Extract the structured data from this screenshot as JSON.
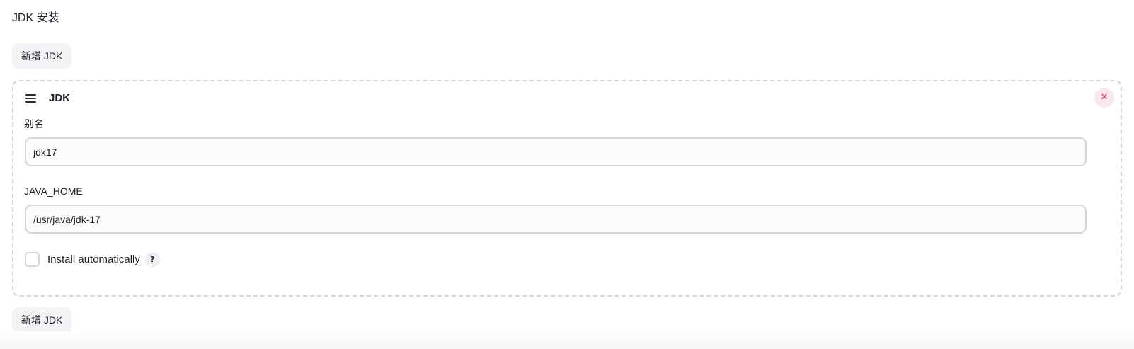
{
  "section": {
    "title": "JDK 安装",
    "add_button_label": "新增 JDK"
  },
  "jdk_card": {
    "title": "JDK",
    "delete_icon": "close-icon",
    "drag_icon": "hamburger-drag-icon",
    "alias_label": "别名",
    "alias_value": "jdk17",
    "java_home_label": "JAVA_HOME",
    "java_home_value": "/usr/java/jdk-17",
    "install_auto_label": "Install automatically",
    "install_auto_checked": false,
    "help_icon_glyph": "?"
  },
  "colors": {
    "accent_danger": "#d42b45",
    "danger_bg": "#fbe7ea",
    "border": "#d4d6de",
    "button_bg": "#f3f3f5"
  }
}
